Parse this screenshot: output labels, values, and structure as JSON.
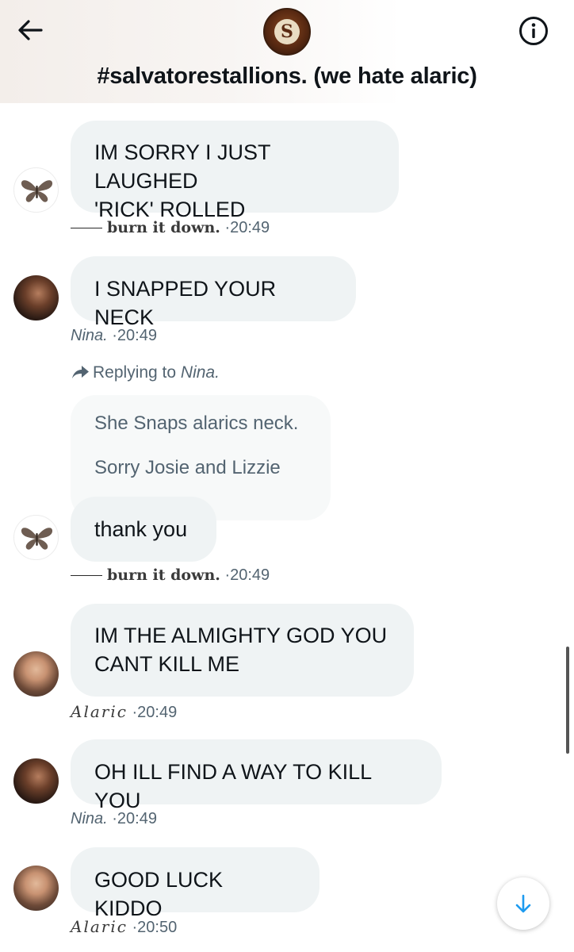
{
  "header": {
    "title": "#salvatorestallions. (we hate alaric)",
    "group_avatar_letter": "S",
    "back_icon": "back-arrow-icon",
    "info_icon": "info-icon"
  },
  "messages": [
    {
      "sender": "burn it down.",
      "text_lines": [
        "IM SORRY I JUST LAUGHED",
        "'RICK' ROLLED"
      ],
      "time": "·20:49"
    },
    {
      "sender": "Nina.",
      "text_lines": [
        "I SNAPPED YOUR NECK"
      ],
      "time": "·20:49"
    },
    {
      "replying_label": "Replying to",
      "replying_to": "Nina.",
      "quoted_lines": [
        "She Snaps alarics neck.",
        "Sorry Josie and Lizzie"
      ],
      "sender": "burn it down.",
      "text_lines": [
        "thank you"
      ],
      "time": "·20:49"
    },
    {
      "sender": "Alaric",
      "text_lines": [
        "IM THE ALMIGHTY GOD YOU",
        "CANT KILL ME"
      ],
      "time": "·20:49"
    },
    {
      "sender": "Nina.",
      "text_lines": [
        "OH ILL FIND A WAY TO KILL YOU"
      ],
      "time": "·20:49"
    },
    {
      "sender": "Alaric",
      "text_lines": [
        "GOOD LUCK KIDDO"
      ],
      "time": "·20:50"
    }
  ],
  "scroll_down_icon": "arrow-down-icon",
  "colors": {
    "bubble": "#eff3f4",
    "meta_text": "#536471",
    "accent": "#1d9bf0"
  }
}
